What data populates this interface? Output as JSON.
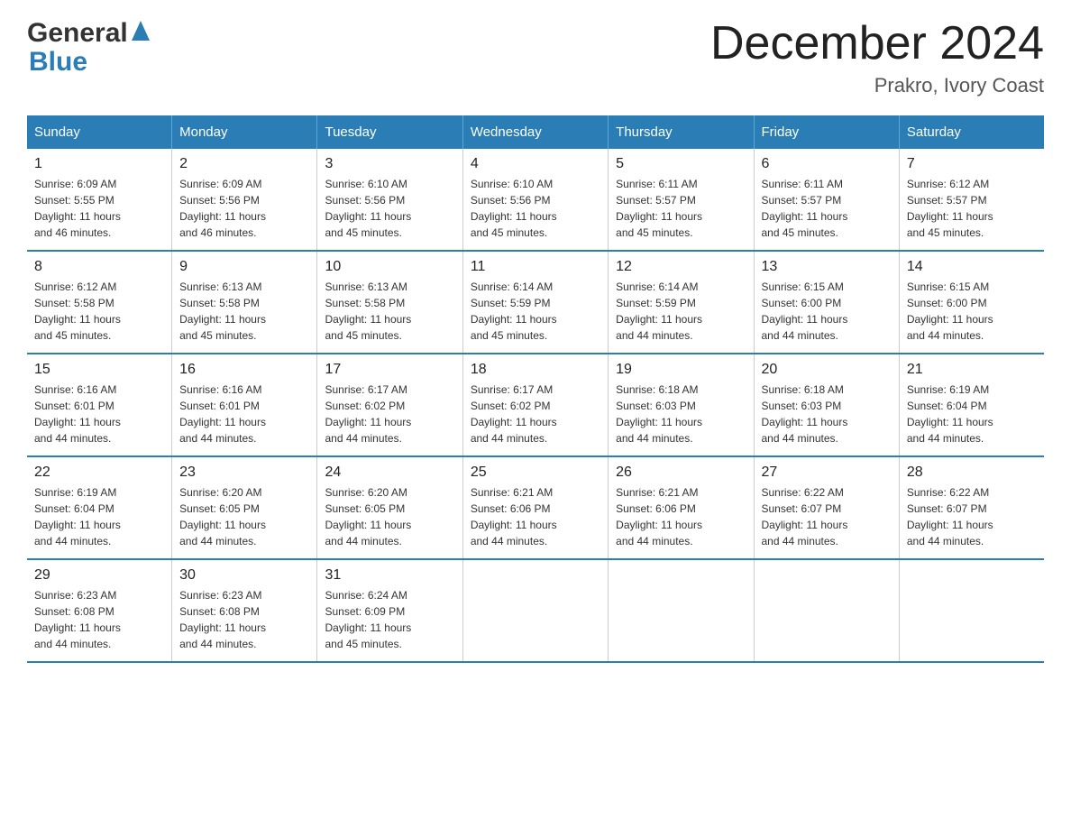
{
  "logo": {
    "general": "General",
    "arrow": "▲",
    "blue": "Blue"
  },
  "title": "December 2024",
  "subtitle": "Prakro, Ivory Coast",
  "weekdays": [
    "Sunday",
    "Monday",
    "Tuesday",
    "Wednesday",
    "Thursday",
    "Friday",
    "Saturday"
  ],
  "weeks": [
    [
      {
        "day": "1",
        "info": "Sunrise: 6:09 AM\nSunset: 5:55 PM\nDaylight: 11 hours\nand 46 minutes."
      },
      {
        "day": "2",
        "info": "Sunrise: 6:09 AM\nSunset: 5:56 PM\nDaylight: 11 hours\nand 46 minutes."
      },
      {
        "day": "3",
        "info": "Sunrise: 6:10 AM\nSunset: 5:56 PM\nDaylight: 11 hours\nand 45 minutes."
      },
      {
        "day": "4",
        "info": "Sunrise: 6:10 AM\nSunset: 5:56 PM\nDaylight: 11 hours\nand 45 minutes."
      },
      {
        "day": "5",
        "info": "Sunrise: 6:11 AM\nSunset: 5:57 PM\nDaylight: 11 hours\nand 45 minutes."
      },
      {
        "day": "6",
        "info": "Sunrise: 6:11 AM\nSunset: 5:57 PM\nDaylight: 11 hours\nand 45 minutes."
      },
      {
        "day": "7",
        "info": "Sunrise: 6:12 AM\nSunset: 5:57 PM\nDaylight: 11 hours\nand 45 minutes."
      }
    ],
    [
      {
        "day": "8",
        "info": "Sunrise: 6:12 AM\nSunset: 5:58 PM\nDaylight: 11 hours\nand 45 minutes."
      },
      {
        "day": "9",
        "info": "Sunrise: 6:13 AM\nSunset: 5:58 PM\nDaylight: 11 hours\nand 45 minutes."
      },
      {
        "day": "10",
        "info": "Sunrise: 6:13 AM\nSunset: 5:58 PM\nDaylight: 11 hours\nand 45 minutes."
      },
      {
        "day": "11",
        "info": "Sunrise: 6:14 AM\nSunset: 5:59 PM\nDaylight: 11 hours\nand 45 minutes."
      },
      {
        "day": "12",
        "info": "Sunrise: 6:14 AM\nSunset: 5:59 PM\nDaylight: 11 hours\nand 44 minutes."
      },
      {
        "day": "13",
        "info": "Sunrise: 6:15 AM\nSunset: 6:00 PM\nDaylight: 11 hours\nand 44 minutes."
      },
      {
        "day": "14",
        "info": "Sunrise: 6:15 AM\nSunset: 6:00 PM\nDaylight: 11 hours\nand 44 minutes."
      }
    ],
    [
      {
        "day": "15",
        "info": "Sunrise: 6:16 AM\nSunset: 6:01 PM\nDaylight: 11 hours\nand 44 minutes."
      },
      {
        "day": "16",
        "info": "Sunrise: 6:16 AM\nSunset: 6:01 PM\nDaylight: 11 hours\nand 44 minutes."
      },
      {
        "day": "17",
        "info": "Sunrise: 6:17 AM\nSunset: 6:02 PM\nDaylight: 11 hours\nand 44 minutes."
      },
      {
        "day": "18",
        "info": "Sunrise: 6:17 AM\nSunset: 6:02 PM\nDaylight: 11 hours\nand 44 minutes."
      },
      {
        "day": "19",
        "info": "Sunrise: 6:18 AM\nSunset: 6:03 PM\nDaylight: 11 hours\nand 44 minutes."
      },
      {
        "day": "20",
        "info": "Sunrise: 6:18 AM\nSunset: 6:03 PM\nDaylight: 11 hours\nand 44 minutes."
      },
      {
        "day": "21",
        "info": "Sunrise: 6:19 AM\nSunset: 6:04 PM\nDaylight: 11 hours\nand 44 minutes."
      }
    ],
    [
      {
        "day": "22",
        "info": "Sunrise: 6:19 AM\nSunset: 6:04 PM\nDaylight: 11 hours\nand 44 minutes."
      },
      {
        "day": "23",
        "info": "Sunrise: 6:20 AM\nSunset: 6:05 PM\nDaylight: 11 hours\nand 44 minutes."
      },
      {
        "day": "24",
        "info": "Sunrise: 6:20 AM\nSunset: 6:05 PM\nDaylight: 11 hours\nand 44 minutes."
      },
      {
        "day": "25",
        "info": "Sunrise: 6:21 AM\nSunset: 6:06 PM\nDaylight: 11 hours\nand 44 minutes."
      },
      {
        "day": "26",
        "info": "Sunrise: 6:21 AM\nSunset: 6:06 PM\nDaylight: 11 hours\nand 44 minutes."
      },
      {
        "day": "27",
        "info": "Sunrise: 6:22 AM\nSunset: 6:07 PM\nDaylight: 11 hours\nand 44 minutes."
      },
      {
        "day": "28",
        "info": "Sunrise: 6:22 AM\nSunset: 6:07 PM\nDaylight: 11 hours\nand 44 minutes."
      }
    ],
    [
      {
        "day": "29",
        "info": "Sunrise: 6:23 AM\nSunset: 6:08 PM\nDaylight: 11 hours\nand 44 minutes."
      },
      {
        "day": "30",
        "info": "Sunrise: 6:23 AM\nSunset: 6:08 PM\nDaylight: 11 hours\nand 44 minutes."
      },
      {
        "day": "31",
        "info": "Sunrise: 6:24 AM\nSunset: 6:09 PM\nDaylight: 11 hours\nand 45 minutes."
      },
      {
        "day": "",
        "info": ""
      },
      {
        "day": "",
        "info": ""
      },
      {
        "day": "",
        "info": ""
      },
      {
        "day": "",
        "info": ""
      }
    ]
  ],
  "colors": {
    "header_bg": "#2a7db5",
    "header_text": "#ffffff",
    "border": "#2a7db5",
    "logo_blue": "#2a7db5"
  }
}
